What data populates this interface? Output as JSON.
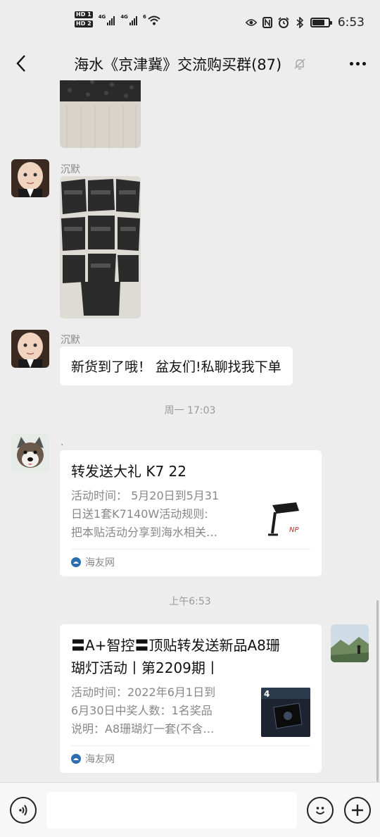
{
  "status_bar": {
    "hd_badges": [
      "HD 1",
      "HD 2"
    ],
    "network_labels": [
      "4G",
      "4G",
      "6"
    ],
    "time": "6:53",
    "icons": [
      "eye-icon",
      "nfc-icon",
      "alarm-icon",
      "bluetooth-icon",
      "battery-icon"
    ]
  },
  "header": {
    "title": "海水《京津冀》交流购买群(87)",
    "back_icon": "back-arrow-icon",
    "mute_icon": "bell-off-icon",
    "more_icon": "more-dots-icon"
  },
  "messages": [
    {
      "type": "image",
      "from": "other",
      "image_desc": "black-gravel-bags-photo-partial"
    },
    {
      "type": "image",
      "from": "other",
      "sender": "沉默",
      "avatar": "baby-avatar",
      "image_desc": "black-gravel-bags-photo"
    },
    {
      "type": "text",
      "from": "other",
      "sender": "沉默",
      "avatar": "baby-avatar",
      "text": "新货到了哦！ 盆友们!私聊找我下单"
    },
    {
      "type": "time",
      "text": "周一 17:03"
    },
    {
      "type": "link_card",
      "from": "other",
      "sender": ".",
      "avatar": "husky-avatar",
      "title": "转发送大礼 K7 22",
      "desc": "活动时间： 5月20日到5月31日送1套K7140W活动规则：把本贴活动分享到海水相关…",
      "desc_lines": [
        "活动时间： 5月20日到5月31",
        "日送1套K7140W活动规则:",
        "把本贴活动分享到海水相关…"
      ],
      "thumb": "lamp-thumbnail",
      "source": "海友网"
    },
    {
      "type": "time",
      "text": "上午6:53"
    },
    {
      "type": "link_card",
      "from": "self",
      "avatar": "mountain-avatar",
      "title_lines": [
        "〓A+智控〓顶贴转发送新品A8珊",
        "瑚灯活动丨第2209期丨"
      ],
      "desc_lines": [
        "活动时间：2022年6月1日到",
        "6月30日中奖人数：1名奖品",
        "说明：A8珊瑚灯一套(不含…"
      ],
      "thumb": "a8-light-thumbnail",
      "source": "海友网"
    }
  ],
  "input_bar": {
    "voice_icon": "voice-icon",
    "input_value": "",
    "emoji_icon": "emoji-icon",
    "plus_icon": "plus-icon"
  },
  "colors": {
    "background": "#ededed",
    "bubble": "#ffffff",
    "secondary_text": "#888888",
    "source_icon": "#2b6fb0"
  }
}
